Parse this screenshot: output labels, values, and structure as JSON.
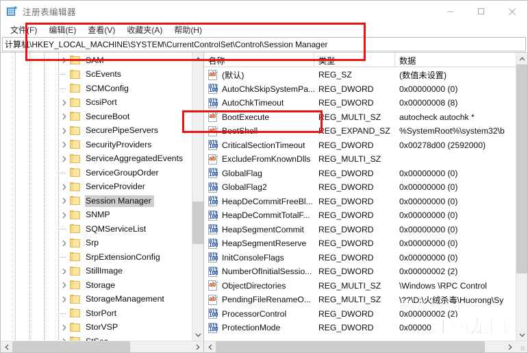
{
  "window": {
    "title": "注册表编辑器",
    "icon": "registry-editor-icon",
    "controls": {
      "minimize": "最小化",
      "maximize": "最大化",
      "close": "关闭"
    }
  },
  "menu": {
    "items": [
      {
        "label": "文件(F)"
      },
      {
        "label": "编辑(E)"
      },
      {
        "label": "查看(V)"
      },
      {
        "label": "收藏夹(A)"
      },
      {
        "label": "帮助(H)"
      }
    ]
  },
  "address": {
    "value": "计算机\\HKEY_LOCAL_MACHINE\\SYSTEM\\CurrentControlSet\\Control\\Session Manager"
  },
  "tree": {
    "items": [
      {
        "label": "SAM",
        "expandable": true,
        "selected": false
      },
      {
        "label": "ScEvents",
        "expandable": false,
        "selected": false
      },
      {
        "label": "SCMConfig",
        "expandable": false,
        "selected": false
      },
      {
        "label": "ScsiPort",
        "expandable": true,
        "selected": false
      },
      {
        "label": "SecureBoot",
        "expandable": true,
        "selected": false
      },
      {
        "label": "SecurePipeServers",
        "expandable": true,
        "selected": false
      },
      {
        "label": "SecurityProviders",
        "expandable": true,
        "selected": false
      },
      {
        "label": "ServiceAggregatedEvents",
        "expandable": true,
        "selected": false
      },
      {
        "label": "ServiceGroupOrder",
        "expandable": false,
        "selected": false
      },
      {
        "label": "ServiceProvider",
        "expandable": true,
        "selected": false
      },
      {
        "label": "Session Manager",
        "expandable": true,
        "selected": true
      },
      {
        "label": "SNMP",
        "expandable": true,
        "selected": false
      },
      {
        "label": "SQMServiceList",
        "expandable": false,
        "selected": false
      },
      {
        "label": "Srp",
        "expandable": true,
        "selected": false
      },
      {
        "label": "SrpExtensionConfig",
        "expandable": false,
        "selected": false
      },
      {
        "label": "StillImage",
        "expandable": true,
        "selected": false
      },
      {
        "label": "Storage",
        "expandable": true,
        "selected": false
      },
      {
        "label": "StorageManagement",
        "expandable": true,
        "selected": false
      },
      {
        "label": "StorPort",
        "expandable": false,
        "selected": false
      },
      {
        "label": "StorVSP",
        "expandable": true,
        "selected": false
      },
      {
        "label": "StSec",
        "expandable": true,
        "selected": false
      }
    ]
  },
  "list": {
    "columns": [
      {
        "label": "名称"
      },
      {
        "label": "类型"
      },
      {
        "label": "数据"
      }
    ],
    "rows": [
      {
        "name": "(默认)",
        "icon": "string-value-icon",
        "type": "REG_SZ",
        "data": "(数值未设置)"
      },
      {
        "name": "AutoChkSkipSystemPa...",
        "icon": "dword-value-icon",
        "type": "REG_DWORD",
        "data": "0x00000000 (0)"
      },
      {
        "name": "AutoChkTimeout",
        "icon": "dword-value-icon",
        "type": "REG_DWORD",
        "data": "0x00000008 (8)"
      },
      {
        "name": "BootExecute",
        "icon": "string-value-icon",
        "type": "REG_MULTI_SZ",
        "data": "autocheck autochk *"
      },
      {
        "name": "BootShell",
        "icon": "string-value-icon",
        "type": "REG_EXPAND_SZ",
        "data": "%SystemRoot%\\system32\\b"
      },
      {
        "name": "CriticalSectionTimeout",
        "icon": "dword-value-icon",
        "type": "REG_DWORD",
        "data": "0x00278d00 (2592000)"
      },
      {
        "name": "ExcludeFromKnownDlls",
        "icon": "string-value-icon",
        "type": "REG_MULTI_SZ",
        "data": ""
      },
      {
        "name": "GlobalFlag",
        "icon": "dword-value-icon",
        "type": "REG_DWORD",
        "data": "0x00000000 (0)"
      },
      {
        "name": "GlobalFlag2",
        "icon": "dword-value-icon",
        "type": "REG_DWORD",
        "data": "0x00000000 (0)"
      },
      {
        "name": "HeapDeCommitFreeBl...",
        "icon": "dword-value-icon",
        "type": "REG_DWORD",
        "data": "0x00000000 (0)"
      },
      {
        "name": "HeapDeCommitTotalF...",
        "icon": "dword-value-icon",
        "type": "REG_DWORD",
        "data": "0x00000000 (0)"
      },
      {
        "name": "HeapSegmentCommit",
        "icon": "dword-value-icon",
        "type": "REG_DWORD",
        "data": "0x00000000 (0)"
      },
      {
        "name": "HeapSegmentReserve",
        "icon": "dword-value-icon",
        "type": "REG_DWORD",
        "data": "0x00000000 (0)"
      },
      {
        "name": "InitConsoleFlags",
        "icon": "dword-value-icon",
        "type": "REG_DWORD",
        "data": "0x00000000 (0)"
      },
      {
        "name": "NumberOfInitialSessio...",
        "icon": "dword-value-icon",
        "type": "REG_DWORD",
        "data": "0x00000002 (2)"
      },
      {
        "name": "ObjectDirectories",
        "icon": "string-value-icon",
        "type": "REG_MULTI_SZ",
        "data": "\\Windows \\RPC Control"
      },
      {
        "name": "PendingFileRenameO...",
        "icon": "string-value-icon",
        "type": "REG_MULTI_SZ",
        "data": "\\??\\D:\\火绒杀毒\\Huorong\\Sy"
      },
      {
        "name": "ProcessorControl",
        "icon": "dword-value-icon",
        "type": "REG_DWORD",
        "data": "0x00000002 (2)"
      },
      {
        "name": "ProtectionMode",
        "icon": "dword-value-icon",
        "type": "REG_DWORD",
        "data": "0x00000"
      }
    ]
  },
  "annotations": {
    "color": "#e81313",
    "boxes": [
      {
        "name": "menu-and-address-highlight"
      },
      {
        "name": "bootexecute-row-highlight"
      }
    ]
  },
  "watermark": {
    "text": "江西龙网"
  }
}
